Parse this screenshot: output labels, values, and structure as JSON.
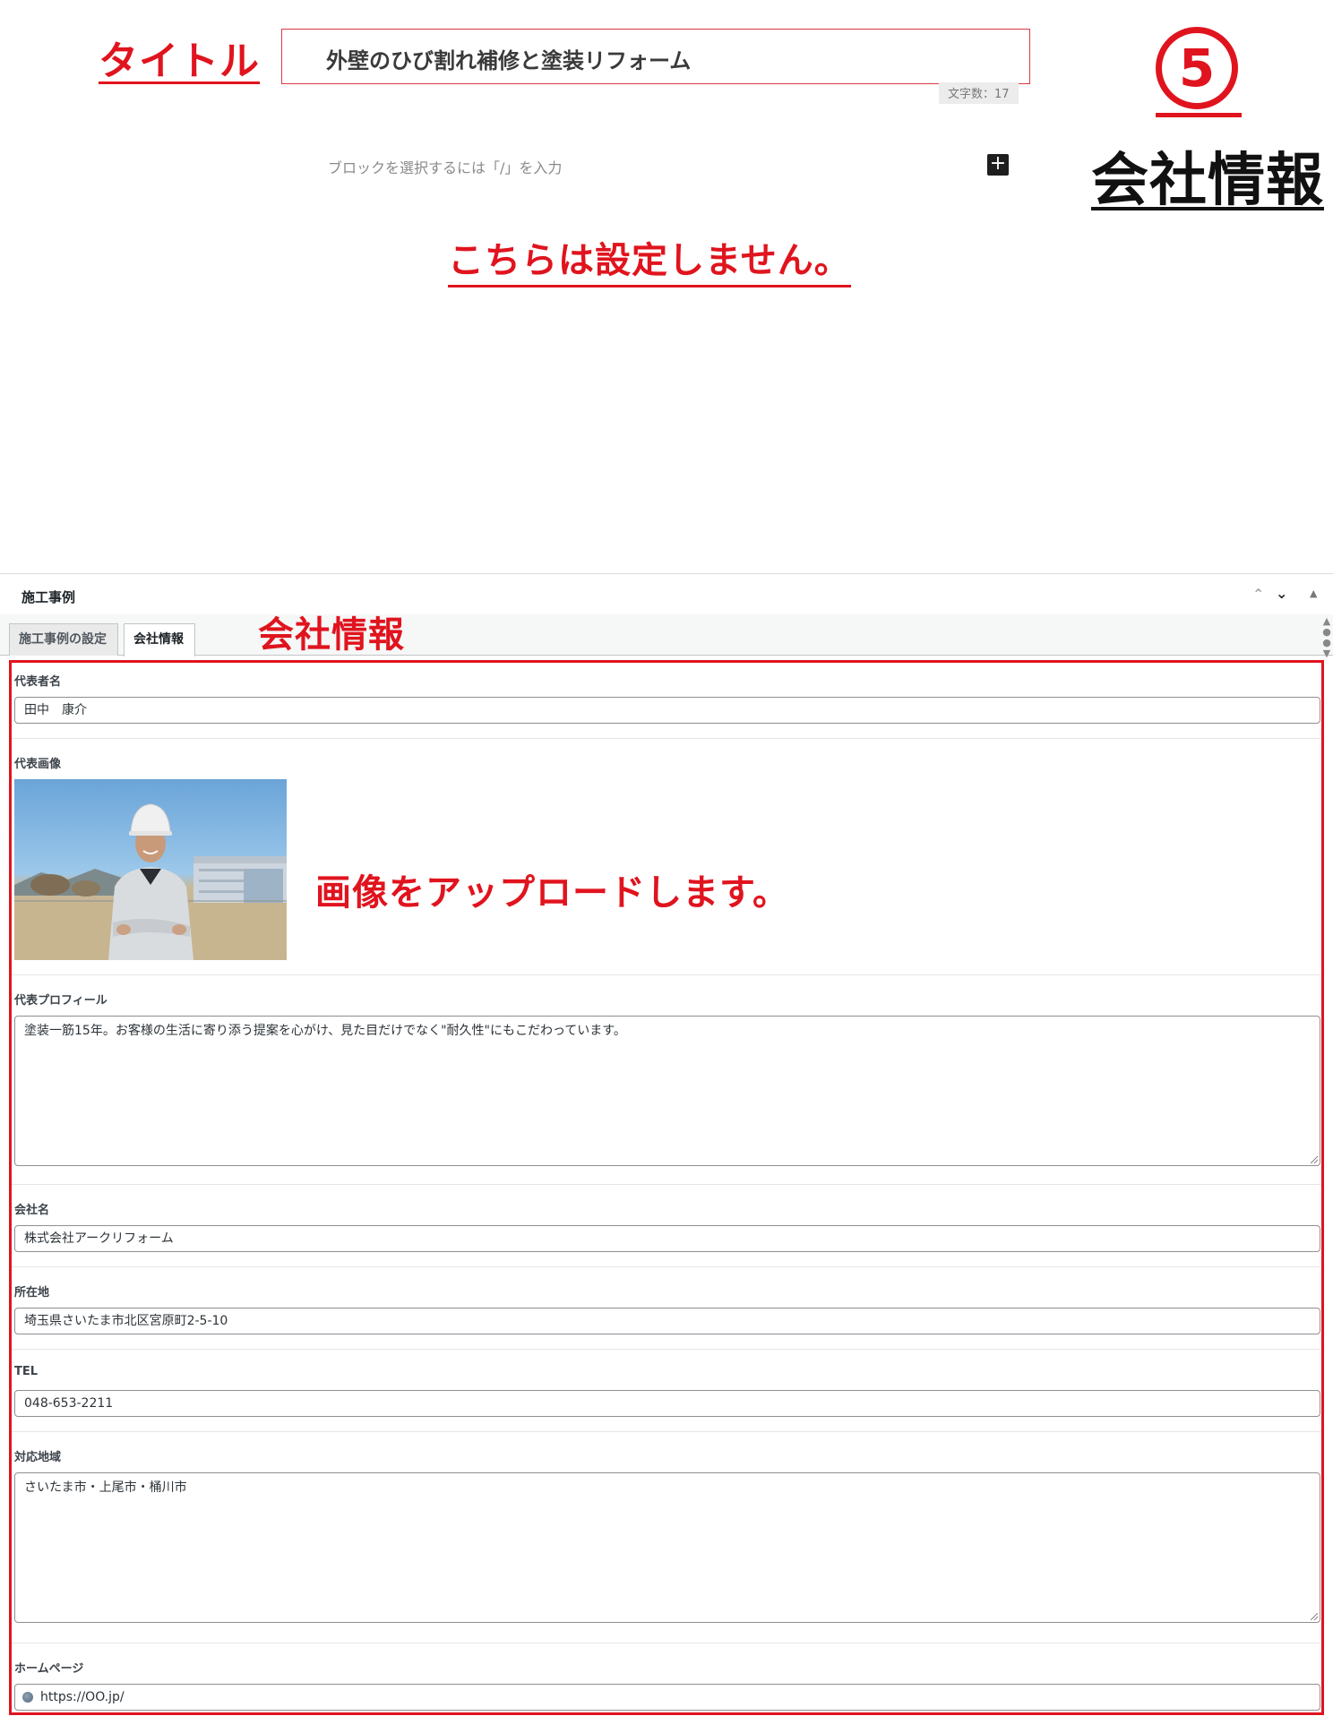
{
  "annotations": {
    "title_label": "タイトル",
    "step_number": "5",
    "step_label": "会社情報",
    "not_set": "こちらは設定しません。",
    "company_tab_note": "会社情報",
    "upload_note": "画像をアップロードします。"
  },
  "editor": {
    "post_title": "外壁のひび割れ補修と塗装リフォーム",
    "char_count": "文字数：17",
    "block_placeholder": "ブロックを選択するには「/」を入力",
    "add_block": "+"
  },
  "metabox": {
    "title": "施工事例",
    "up_icon": "chevron-up-icon",
    "down_icon": "chevron-down-icon",
    "tabs": [
      {
        "label": "施工事例の設定",
        "active": false
      },
      {
        "label": "会社情報",
        "active": true
      }
    ]
  },
  "fields": {
    "rep_name": {
      "label": "代表者名",
      "value": "田中　康介"
    },
    "rep_image": {
      "label": "代表画像"
    },
    "rep_profile": {
      "label": "代表プロフィール",
      "value": "塗装一筋15年。お客様の生活に寄り添う提案を心がけ、見た目だけでなく\"耐久性\"にもこだわっています。"
    },
    "company_name": {
      "label": "会社名",
      "value": "株式会社アークリフォーム"
    },
    "address": {
      "label": "所在地",
      "value": "埼玉県さいたま市北区宮原町2-5-10"
    },
    "tel": {
      "label": "TEL",
      "value": "048-653-2211"
    },
    "service_area": {
      "label": "対応地域",
      "value": "さいたま市・上尾市・桶川市"
    },
    "homepage": {
      "label": "ホームページ",
      "value": "https://OO.jp/"
    }
  },
  "colors": {
    "annotation_red": "#e0141e",
    "input_border": "#8c8f94",
    "tab_border": "#c3c4c7"
  }
}
